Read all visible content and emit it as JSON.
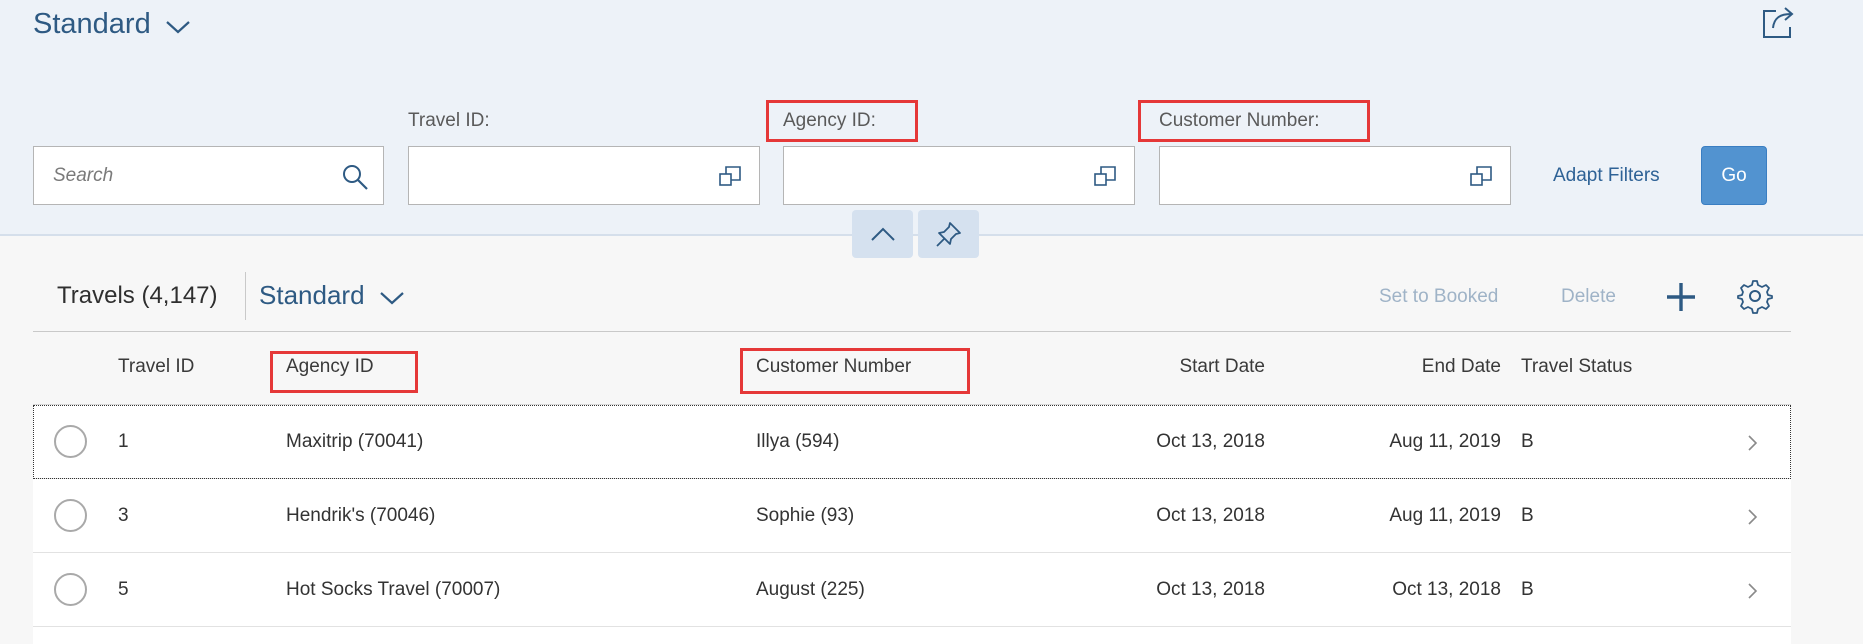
{
  "header": {
    "variant_title": "Standard",
    "icons": {
      "variant_chevron": "chevron-down-icon",
      "share": "share-icon"
    }
  },
  "filterbar": {
    "search": {
      "placeholder": "Search",
      "value": ""
    },
    "fields": [
      {
        "label": "Travel ID:",
        "value": ""
      },
      {
        "label": "Agency ID:",
        "value": ""
      },
      {
        "label": "Customer Number:",
        "value": ""
      }
    ],
    "adapt_filters": "Adapt Filters",
    "go": "Go",
    "icons": {
      "search": "search-icon",
      "value_help": "value-help-icon",
      "collapse": "chevron-up-icon",
      "pin": "pin-icon"
    }
  },
  "table": {
    "title": "Travels (4,147)",
    "variant_title": "Standard",
    "actions": {
      "set_to_booked": "Set to Booked",
      "delete": "Delete"
    },
    "icons": {
      "add": "add-icon",
      "settings": "gear-icon",
      "row_nav": "chevron-right-icon"
    },
    "columns": [
      "Travel ID",
      "Agency ID",
      "Customer Number",
      "Start Date",
      "End Date",
      "Travel Status"
    ],
    "rows": [
      {
        "travel_id": "1",
        "agency": "Maxitrip (70041)",
        "customer": "Illya (594)",
        "start": "Oct 13, 2018",
        "end": "Aug 11, 2019",
        "status": "B"
      },
      {
        "travel_id": "3",
        "agency": "Hendrik's (70046)",
        "customer": "Sophie (93)",
        "start": "Oct 13, 2018",
        "end": "Aug 11, 2019",
        "status": "B"
      },
      {
        "travel_id": "5",
        "agency": "Hot Socks Travel (70007)",
        "customer": "August (225)",
        "start": "Oct 13, 2018",
        "end": "Oct 13, 2018",
        "status": "B"
      }
    ]
  },
  "colors": {
    "accent": "#2e5a83",
    "highlight": "#e53838",
    "go_button": "#5293d0",
    "header_bg": "#edf2f8"
  }
}
